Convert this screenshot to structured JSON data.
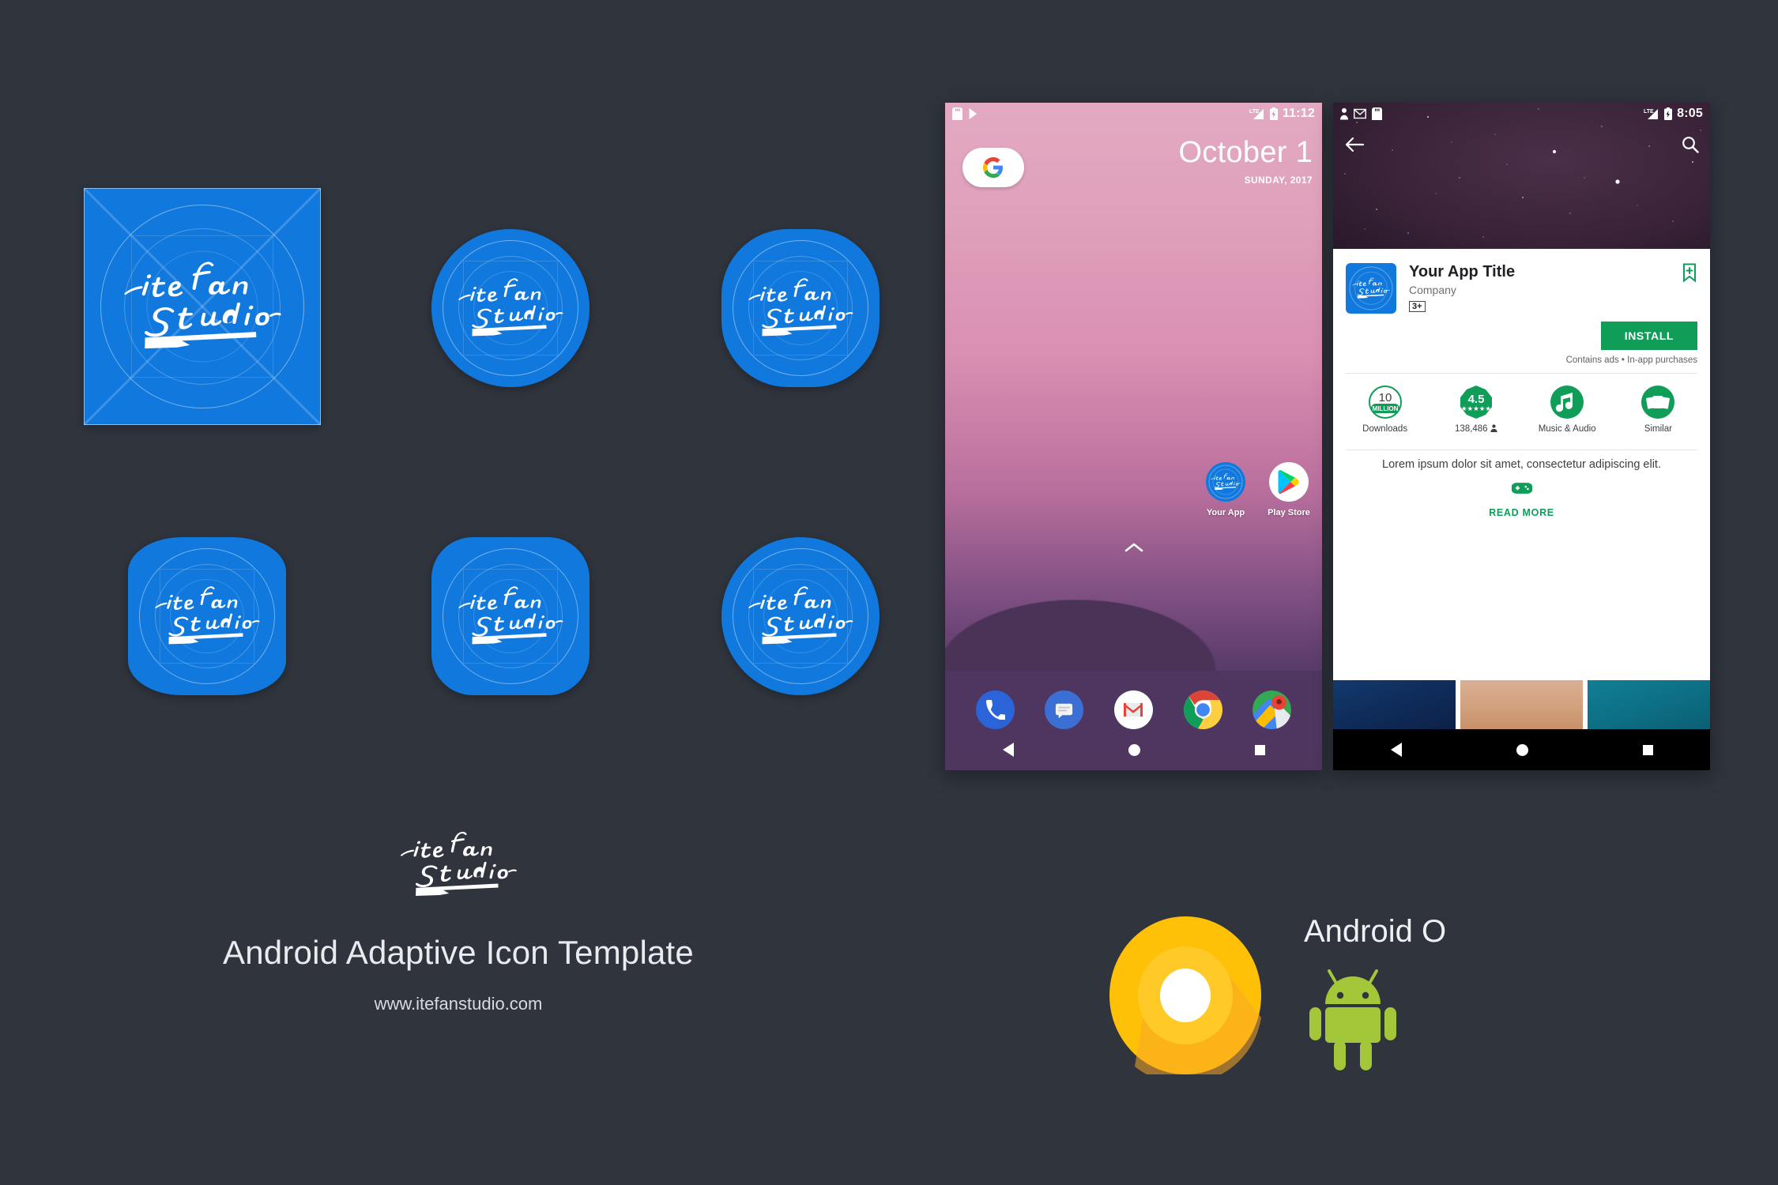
{
  "meta": {
    "background_color": "#2f343d",
    "brand_blue": "#1179dd",
    "play_green": "#0f9d58",
    "android_green": "#a4c639",
    "oreo_yellow": "#ffc107"
  },
  "icon_grid": {
    "brand_text_line1": "iteFan",
    "brand_text_line2": "Studio",
    "shapes": [
      {
        "name": "full-bleed-square",
        "label": "Square"
      },
      {
        "name": "circle",
        "label": "Circle"
      },
      {
        "name": "rounded-square",
        "label": "Rounded Square"
      },
      {
        "name": "squircle",
        "label": "Squircle"
      },
      {
        "name": "rounded-rectangle",
        "label": "Rounded Rectangle"
      },
      {
        "name": "teardrop",
        "label": "Teardrop"
      }
    ]
  },
  "home_screen": {
    "status_bar": {
      "left_icons": [
        "sd-card-icon",
        "play-store-icon"
      ],
      "network_label": "LTE",
      "battery_icon": "battery-charging-icon",
      "time": "11:12"
    },
    "search_widget": {
      "icon": "google-g-icon"
    },
    "date_widget": {
      "date": "October 1",
      "subtitle": "SUNDAY, 2017"
    },
    "apps": [
      {
        "name": "your-app",
        "label": "Your App"
      },
      {
        "name": "play-store",
        "label": "Play Store"
      }
    ],
    "drawer_handle": "chevron-up-icon",
    "dock": [
      {
        "name": "phone",
        "label": "Phone"
      },
      {
        "name": "messages",
        "label": "Messages"
      },
      {
        "name": "gmail",
        "label": "Gmail"
      },
      {
        "name": "chrome",
        "label": "Chrome"
      },
      {
        "name": "maps",
        "label": "Maps"
      }
    ],
    "nav_bar": [
      "back-button",
      "home-button",
      "recents-button"
    ]
  },
  "play_store": {
    "status_bar": {
      "left_icons": [
        "person-icon",
        "gmail-icon",
        "sd-card-icon"
      ],
      "network_label": "LTE",
      "battery_icon": "battery-charging-icon",
      "time": "8:05"
    },
    "action_bar": {
      "back": "back-arrow-icon",
      "search": "search-icon"
    },
    "app": {
      "title": "Your App Title",
      "company": "Company",
      "content_rating": "3+",
      "bookmark": "add-to-wishlist-icon"
    },
    "install_button": "INSTALL",
    "ads_note": "Contains ads • In-app purchases",
    "stats": [
      {
        "name": "downloads",
        "value": "10",
        "unit": "MILLION",
        "caption": "Downloads",
        "icon": "downloads-circle-icon"
      },
      {
        "name": "rating",
        "value": "4.5",
        "stars": 4.5,
        "caption": "138,486",
        "icon": "rating-badge-icon"
      },
      {
        "name": "category",
        "caption": "Music & Audio",
        "icon": "music-note-icon"
      },
      {
        "name": "similar",
        "caption": "Similar",
        "icon": "similar-cards-icon"
      }
    ],
    "description": "Lorem ipsum dolor sit amet, consectetur adipiscing elit.",
    "category_icon": "gamepad-icon",
    "read_more": "READ MORE",
    "screenshots": [
      "night-sky",
      "sand-dune",
      "ocean"
    ],
    "nav_bar": [
      "back-button",
      "home-button",
      "recents-button"
    ]
  },
  "footer": {
    "logo_line1": "iteFan",
    "logo_line2": "Studio",
    "title": "Android Adaptive Icon Template",
    "url": "www.itefanstudio.com"
  },
  "android_o": {
    "label": "Android O",
    "oreo_icon": "android-oreo-logo",
    "robot_icon": "android-robot-icon"
  }
}
